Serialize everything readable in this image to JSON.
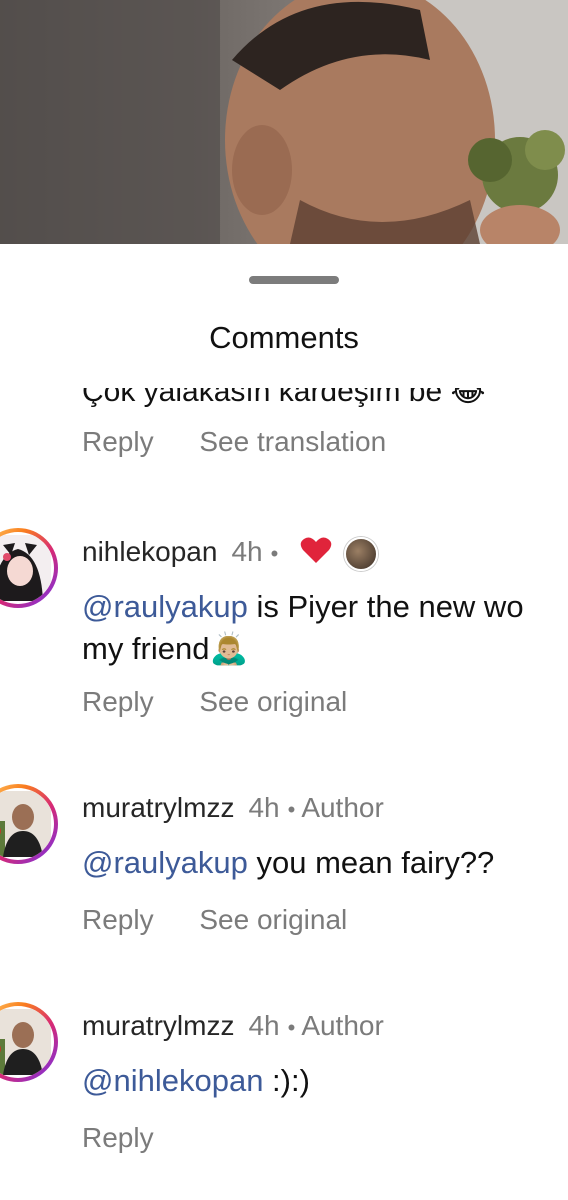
{
  "header": {
    "title": "Comments"
  },
  "previous_comment": {
    "partial_text": "Çok yalakasın kardeşim be 😂",
    "actions": {
      "reply": "Reply",
      "translate": "See translation"
    }
  },
  "comments": [
    {
      "username": "nihlekopan",
      "time": "4h",
      "separator": "•",
      "mention": "@raulyakup",
      "text_line1": " is Piyer the new wo",
      "text_line2": "my friend🙇🏼‍♂️",
      "actions": {
        "reply": "Reply",
        "see": "See original"
      },
      "liked_by_author": true,
      "heart_color": "#e0243b"
    },
    {
      "username": "muratrylmzz",
      "time": "4h",
      "separator": "•",
      "author_label": "Author",
      "mention": "@raulyakup",
      "text_line1": " you mean fairy??",
      "actions": {
        "reply": "Reply",
        "see": "See original"
      }
    },
    {
      "username": "muratrylmzz",
      "time": "4h",
      "separator": "•",
      "author_label": "Author",
      "mention": "@nihlekopan",
      "text_line1": " :):)",
      "actions": {
        "reply": "Reply"
      }
    }
  ],
  "colors": {
    "mention": "#3d5a98",
    "muted": "#7b7b7b",
    "handle": "#7c7c7c"
  }
}
